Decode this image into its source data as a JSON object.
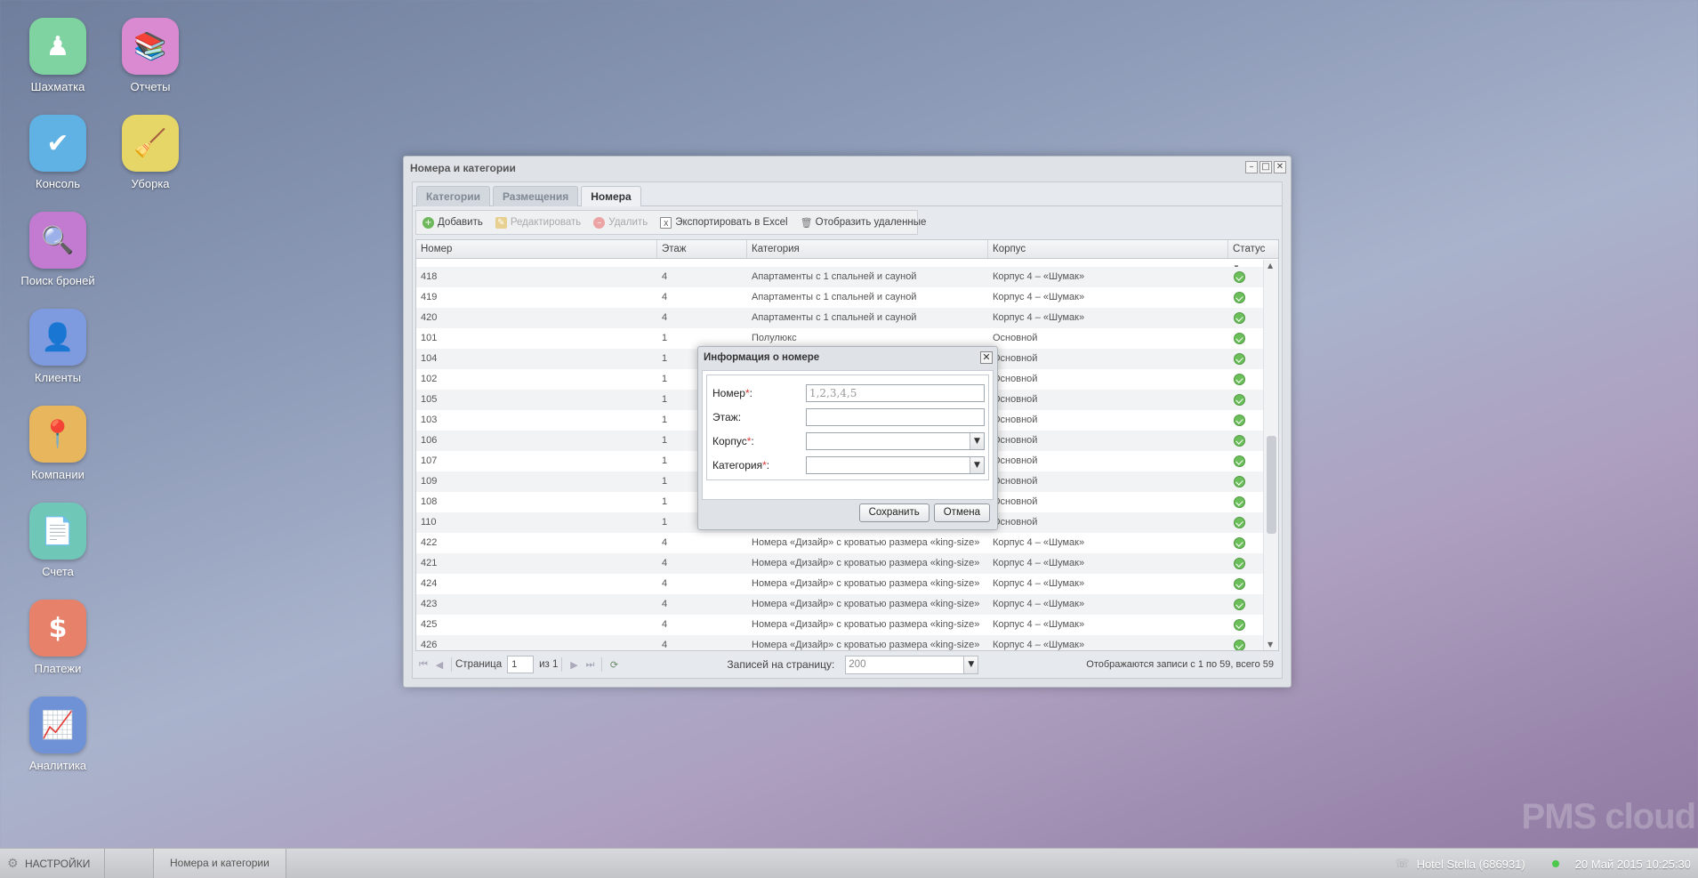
{
  "colors": {
    "shakhmatka": "#7fd3a0",
    "reports": "#d98ad0",
    "console": "#5fb2e3",
    "cleaning": "#e6d667",
    "search": "#c27bd0",
    "clients": "#7f9be0",
    "companies": "#e8b65c",
    "invoices": "#6fc7b8",
    "payments": "#e8816a",
    "analytics": "#6f92d6",
    "status_ok": "#6bbf5a",
    "required_mark": "#dd3333"
  },
  "desktop": {
    "icons": [
      {
        "label": "Шахматка",
        "icon": "chess-piece-icon"
      },
      {
        "label": "Отчеты",
        "icon": "books-icon"
      },
      {
        "label": "Консоль",
        "icon": "checkmark-icon"
      },
      {
        "label": "Уборка",
        "icon": "broom-icon"
      },
      {
        "label": "Поиск броней",
        "icon": "magnifier-icon"
      },
      {
        "label": "Клиенты",
        "icon": "person-icon"
      },
      {
        "label": "Компании",
        "icon": "map-pin-icon"
      },
      {
        "label": "Счета",
        "icon": "document-icon"
      },
      {
        "label": "Платежи",
        "icon": "dollar-icon"
      },
      {
        "label": "Аналитика",
        "icon": "line-chart-icon"
      }
    ]
  },
  "window": {
    "title": "Номера и категории",
    "tabs": [
      {
        "label": "Категории"
      },
      {
        "label": "Размещения"
      },
      {
        "label": "Номера"
      }
    ],
    "toolbar": {
      "add": "Добавить",
      "edit": "Редактировать",
      "delete": "Удалить",
      "export": "Экспортировать в Excel",
      "show_deleted": "Отобразить удаленные"
    },
    "columns": {
      "number": "Номер",
      "floor": "Этаж",
      "category": "Категория",
      "building": "Корпус",
      "status": "Статус"
    },
    "rows": [
      {
        "number": "418",
        "floor": "4",
        "category": "Апартаменты с 1 спальней и сауной",
        "building": "Корпус 4 – «Шумак»"
      },
      {
        "number": "419",
        "floor": "4",
        "category": "Апартаменты с 1 спальней и сауной",
        "building": "Корпус 4 – «Шумак»"
      },
      {
        "number": "420",
        "floor": "4",
        "category": "Апартаменты с 1 спальней и сауной",
        "building": "Корпус 4 – «Шумак»"
      },
      {
        "number": "101",
        "floor": "1",
        "category": "Полулюкс",
        "building": "Основной"
      },
      {
        "number": "104",
        "floor": "1",
        "category": "",
        "building": "Основной"
      },
      {
        "number": "102",
        "floor": "1",
        "category": "",
        "building": "Основной"
      },
      {
        "number": "105",
        "floor": "1",
        "category": "",
        "building": "Основной"
      },
      {
        "number": "103",
        "floor": "1",
        "category": "",
        "building": "Основной"
      },
      {
        "number": "106",
        "floor": "1",
        "category": "",
        "building": "Основной"
      },
      {
        "number": "107",
        "floor": "1",
        "category": "",
        "building": "Основной"
      },
      {
        "number": "109",
        "floor": "1",
        "category": "",
        "building": "Основной"
      },
      {
        "number": "108",
        "floor": "1",
        "category": "",
        "building": "Основной"
      },
      {
        "number": "110",
        "floor": "1",
        "category": "",
        "building": "Основной"
      },
      {
        "number": "422",
        "floor": "4",
        "category": "Номера «Дизайр» с кроватью размера «king-size»",
        "building": "Корпус 4 – «Шумак»"
      },
      {
        "number": "421",
        "floor": "4",
        "category": "Номера «Дизайр» с кроватью размера «king-size»",
        "building": "Корпус 4 – «Шумак»"
      },
      {
        "number": "424",
        "floor": "4",
        "category": "Номера «Дизайр» с кроватью размера «king-size»",
        "building": "Корпус 4 – «Шумак»"
      },
      {
        "number": "423",
        "floor": "4",
        "category": "Номера «Дизайр» с кроватью размера «king-size»",
        "building": "Корпус 4 – «Шумак»"
      },
      {
        "number": "425",
        "floor": "4",
        "category": "Номера «Дизайр» с кроватью размера «king-size»",
        "building": "Корпус 4 – «Шумак»"
      },
      {
        "number": "426",
        "floor": "4",
        "category": "Номера «Дизайр» с кроватью размера «king-size»",
        "building": "Корпус 4 – «Шумак»"
      }
    ],
    "pager": {
      "page_label": "Страница",
      "page_value": "1",
      "of_label": "из 1",
      "per_page_label": "Записей на страницу:",
      "per_page_value": "200",
      "summary": "Отображаются записи с 1 по 59, всего 59"
    }
  },
  "dialog": {
    "title": "Информация о номере",
    "number_label": "Номер",
    "number_placeholder": "1,2,3,4,5",
    "floor_label": "Этаж:",
    "building_label": "Корпус",
    "category_label": "Категория",
    "required_mark": "*",
    "colon": ":",
    "save": "Сохранить",
    "cancel": "Отмена"
  },
  "taskbar": {
    "settings": "НАСТРОЙКИ",
    "task": "Номера и категории",
    "hotel": "Hotel Stella (686931)",
    "datetime": "20 Май 2015 10:25:30"
  },
  "watermark": "PMS cloud"
}
